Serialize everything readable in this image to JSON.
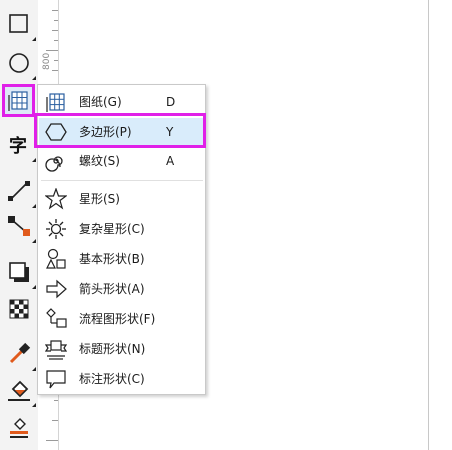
{
  "ruler": {
    "mark": "800"
  },
  "toolbox": {
    "tools": [
      {
        "name": "rectangle-tool",
        "icon": "rectangle-icon"
      },
      {
        "name": "ellipse-tool",
        "icon": "ellipse-icon"
      },
      {
        "name": "graph-paper-tool",
        "icon": "graph-paper-icon"
      },
      {
        "name": "text-tool",
        "icon": "text-icon",
        "glyph": "字"
      },
      {
        "name": "line-tool",
        "icon": "line-icon"
      },
      {
        "name": "connector-tool",
        "icon": "connector-icon"
      },
      {
        "name": "shadow-tool",
        "icon": "shadow-icon"
      },
      {
        "name": "transparency-tool",
        "icon": "transparency-icon"
      },
      {
        "name": "eyedropper-tool",
        "icon": "eyedropper-icon"
      },
      {
        "name": "fill-tool",
        "icon": "fill-bucket-icon"
      },
      {
        "name": "smart-fill-tool",
        "icon": "smart-fill-icon"
      }
    ]
  },
  "flyout_menu": {
    "items": [
      {
        "label": "图纸(G)",
        "shortcut": "D",
        "icon": "graph-paper-icon"
      },
      {
        "label": "多边形(P)",
        "shortcut": "Y",
        "icon": "polygon-icon",
        "selected": true
      },
      {
        "label": "螺纹(S)",
        "shortcut": "A",
        "icon": "spiral-icon"
      },
      {
        "label": "星形(S)",
        "shortcut": "",
        "icon": "star-icon"
      },
      {
        "label": "复杂星形(C)",
        "shortcut": "",
        "icon": "complex-star-icon"
      },
      {
        "label": "基本形状(B)",
        "shortcut": "",
        "icon": "basic-shapes-icon"
      },
      {
        "label": "箭头形状(A)",
        "shortcut": "",
        "icon": "arrow-shapes-icon"
      },
      {
        "label": "流程图形状(F)",
        "shortcut": "",
        "icon": "flowchart-shapes-icon"
      },
      {
        "label": "标题形状(N)",
        "shortcut": "",
        "icon": "banner-shapes-icon"
      },
      {
        "label": "标注形状(C)",
        "shortcut": "",
        "icon": "callout-shapes-icon"
      }
    ]
  },
  "colors": {
    "highlight": "#e020e8",
    "selection": "#d9ecfb",
    "accent_orange": "#e05a1c"
  }
}
